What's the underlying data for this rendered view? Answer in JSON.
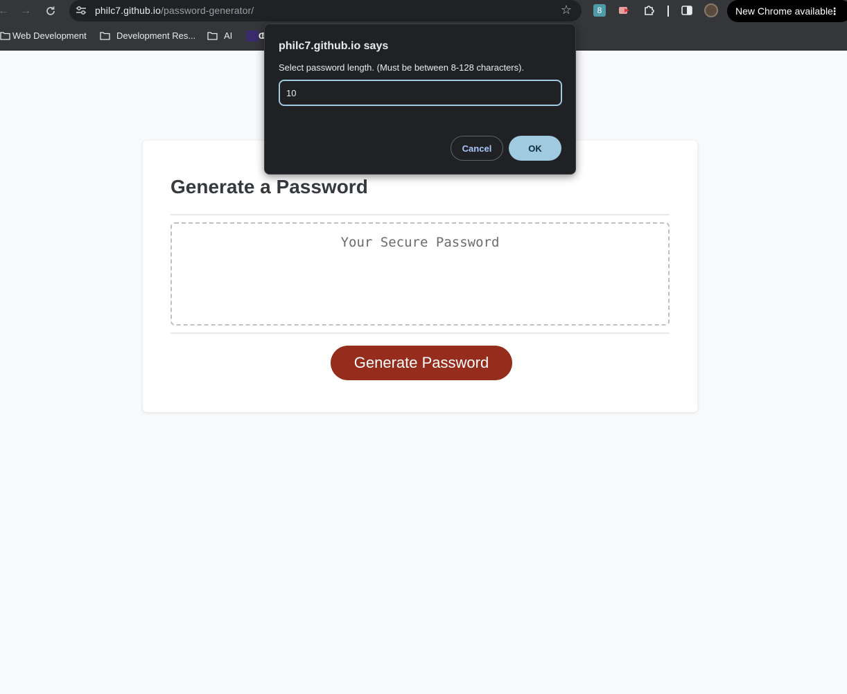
{
  "browser": {
    "url_host": "philc7.github.io",
    "url_path": "/password-generator/",
    "extension_badge": "8",
    "update_label": "New Chrome available",
    "kebab": "⋮",
    "bookmarks": [
      {
        "label": "Web Development",
        "icon": "folder-icon"
      },
      {
        "label": "Development Res...",
        "icon": "folder-icon"
      },
      {
        "label": "AI",
        "icon": "folder-icon"
      },
      {
        "label": "E",
        "icon": "c-logo-icon"
      }
    ]
  },
  "page": {
    "title": "Generate a Password",
    "password_placeholder": "Your Secure Password",
    "generate_button": "Generate Password",
    "accent_color": "#962d1c"
  },
  "dialog": {
    "title": "philc7.github.io says",
    "message": "Select password length. (Must be between 8-128 characters).",
    "input_value": "10",
    "cancel_label": "Cancel",
    "ok_label": "OK",
    "accent_color": "#9fcae0"
  }
}
